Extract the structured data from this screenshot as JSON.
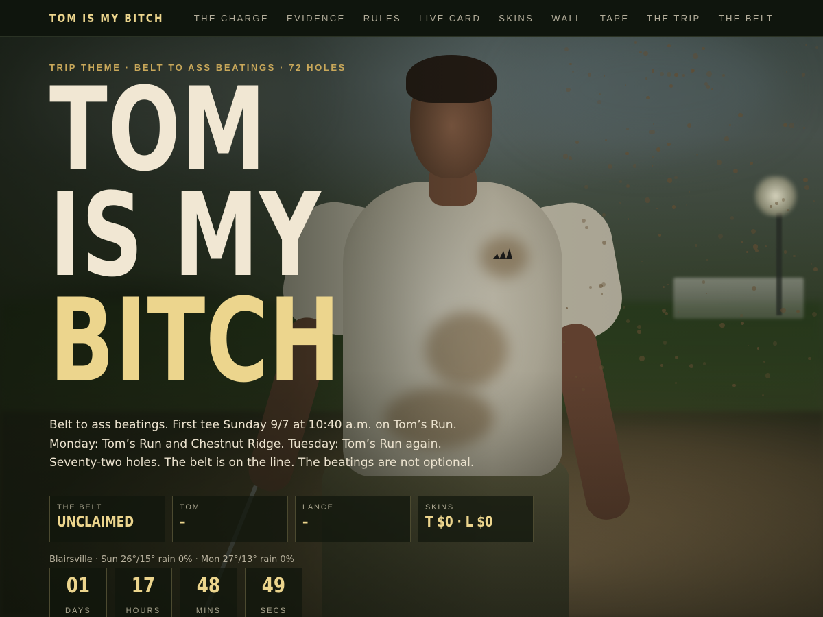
{
  "header": {
    "brand": "TOM IS MY BITCH",
    "nav": [
      "THE CHARGE",
      "EVIDENCE",
      "RULES",
      "LIVE CARD",
      "SKINS",
      "WALL",
      "TAPE",
      "THE TRIP",
      "THE BELT"
    ]
  },
  "hero": {
    "eyebrow": "TRIP THEME · BELT TO ASS BEATINGS · 72 HOLES",
    "headline": {
      "line1": "TOM",
      "line2": "IS MY",
      "line3": "BITCH"
    },
    "intro": [
      "Belt to ass beatings. First tee Sunday 9/7 at 10:40 a.m. on Tom’s Run.",
      "Monday: Tom’s Run and Chestnut Ridge. Tuesday: Tom’s Run again.",
      "Seventy-two holes. The belt is on the line. The beatings are not optional."
    ],
    "stats": [
      {
        "label": "THE BELT",
        "value": "UNCLAIMED"
      },
      {
        "label": "TOM",
        "value": "–"
      },
      {
        "label": "LANCE",
        "value": "–"
      },
      {
        "label": "SKINS",
        "value": "T $0 · L $0"
      }
    ],
    "weather": "Blairsville · Sun 26°/15° rain 0% · Mon 27°/13° rain 0%",
    "countdown": [
      {
        "value": "01",
        "label": "DAYS"
      },
      {
        "value": "17",
        "label": "HOURS"
      },
      {
        "value": "48",
        "label": "MINS"
      },
      {
        "value": "49",
        "label": "SECS"
      }
    ]
  },
  "colors": {
    "gold": "#ecd58d",
    "cream": "#f1e7d3",
    "eyebrow": "#c9a85a",
    "topbar": "#0f150d"
  }
}
